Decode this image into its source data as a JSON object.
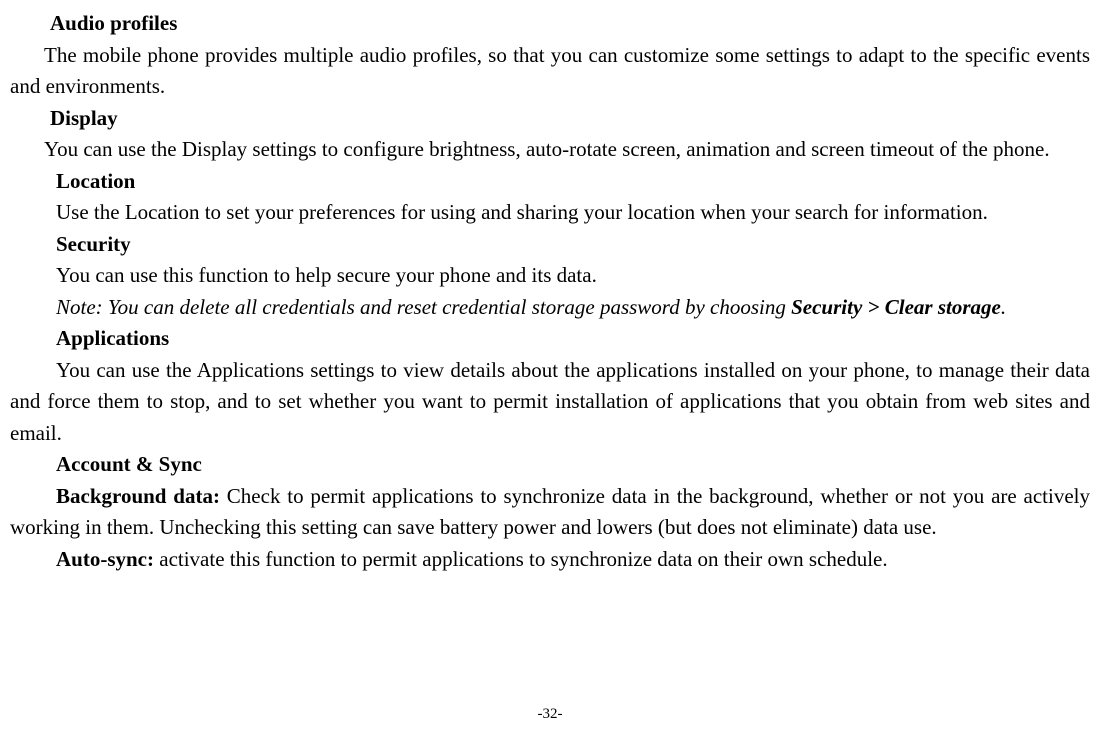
{
  "sections": {
    "audio_profiles": {
      "heading": "Audio profiles",
      "body": "The mobile phone provides multiple audio profiles, so that you can customize some settings to adapt to the specific events and environments."
    },
    "display": {
      "heading": "Display",
      "body": "You can use the Display settings to configure brightness, auto-rotate screen, animation and screen timeout of the phone."
    },
    "location": {
      "heading": "Location",
      "body": "Use the Location to set your preferences for using and sharing your location when your search for information."
    },
    "security": {
      "heading": "Security",
      "body": "You can use this function to help secure your phone and its data.",
      "note_prefix": "Note: You can delete all credentials and reset credential storage password by choosing ",
      "note_bold": "Security > Clear storage",
      "note_suffix": "."
    },
    "applications": {
      "heading": "Applications",
      "body": "You can use the Applications settings to view details about the applications installed on your phone, to manage their data and force them to stop, and to set whether you want to permit installation of applications that you obtain from web sites and email."
    },
    "account_sync": {
      "heading": "Account & Sync",
      "bg_label": "Background data: ",
      "bg_body": "Check to permit applications to synchronize data in the background, whether or not you are actively working in them. Unchecking this setting can save battery power and lowers (but does not eliminate) data use.",
      "auto_label": "Auto-sync: ",
      "auto_body": "activate this function to permit applications to synchronize data on their own schedule."
    }
  },
  "page_number": "-32-"
}
